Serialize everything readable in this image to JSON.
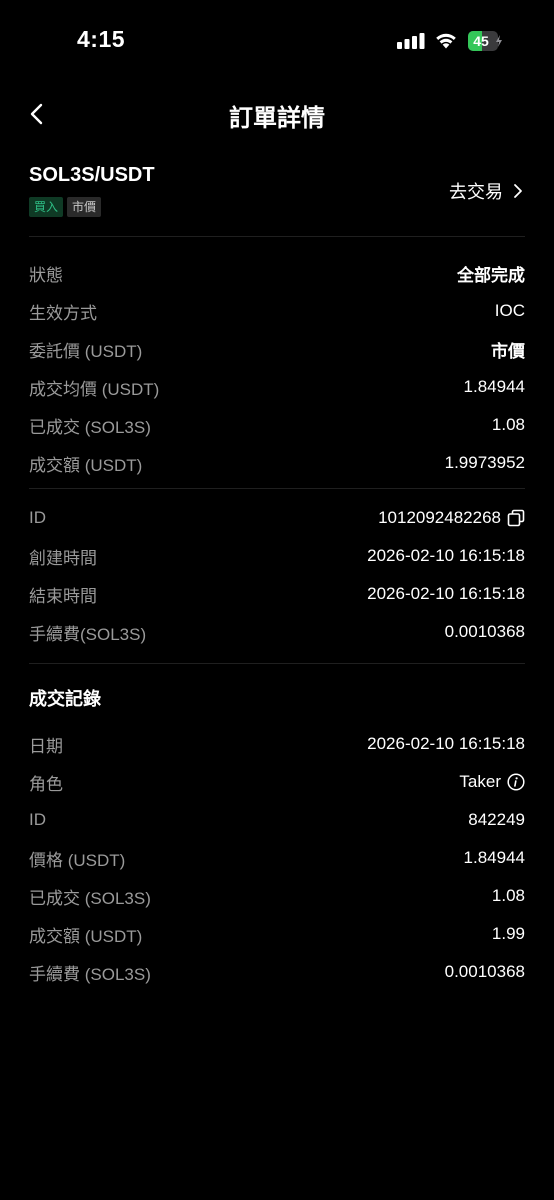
{
  "status_bar": {
    "time": "4:15",
    "battery_level": "45",
    "battery_fraction": 0.45,
    "icons": [
      "signal-icon",
      "wifi-icon",
      "battery-icon",
      "bolt-icon"
    ]
  },
  "nav": {
    "title": "訂單詳情",
    "back_icon": "chevron-left-icon"
  },
  "order": {
    "pair": "SOL3S/USDT",
    "side_tag": "買入",
    "type_tag": "市價",
    "trade_link": "去交易"
  },
  "details": [
    {
      "label": "狀態",
      "value": "全部完成"
    },
    {
      "label": "生效方式",
      "value": "IOC"
    },
    {
      "label": "委託價 (USDT)",
      "value": "市價"
    },
    {
      "label": "成交均價 (USDT)",
      "value": "1.84944"
    },
    {
      "label": "已成交 (SOL3S)",
      "value": "1.08"
    },
    {
      "label": "成交額 (USDT)",
      "value": "1.9973952"
    }
  ],
  "meta": [
    {
      "label": "ID",
      "value": "1012092482268"
    },
    {
      "label": "創建時間",
      "value": "2026-02-10 16:15:18"
    },
    {
      "label": "結束時間",
      "value": "2026-02-10 16:15:18"
    },
    {
      "label": "手續費(SOL3S)",
      "value": "0.0010368"
    }
  ],
  "fills": {
    "title": "成交記錄",
    "rows": [
      {
        "label": "日期",
        "value": "2026-02-10 16:15:18"
      },
      {
        "label": "角色",
        "value": "Taker"
      },
      {
        "label": "ID",
        "value": "842249"
      },
      {
        "label": "價格 (USDT)",
        "value": "1.84944"
      },
      {
        "label": "已成交 (SOL3S)",
        "value": "1.08"
      },
      {
        "label": "成交額 (USDT)",
        "value": "1.99"
      },
      {
        "label": "手續費 (SOL3S)",
        "value": "0.0010368"
      }
    ]
  },
  "colors": {
    "background": "#000000",
    "label_gray": "#9a9a9a",
    "buy_green": "#2ebd85",
    "battery_green": "#34c759"
  }
}
